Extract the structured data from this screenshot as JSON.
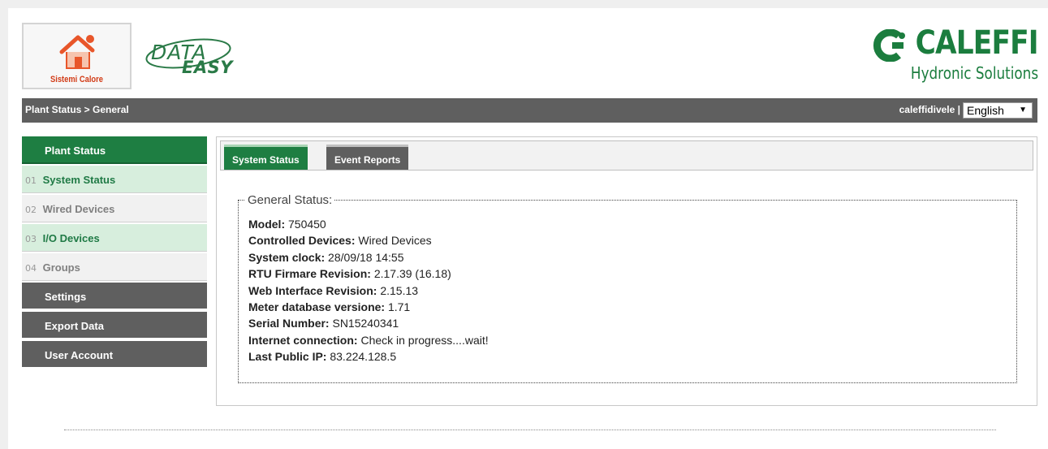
{
  "header": {
    "logo_text": "Sistemi Calore",
    "product_logo": {
      "word1": "DATA",
      "word2": "EASY"
    },
    "brand": {
      "name": "CALEFFI",
      "tagline": "Hydronic Solutions"
    }
  },
  "nav": {
    "breadcrumb": "Plant Status > General",
    "user": "caleffidivele |",
    "language": "English"
  },
  "sidebar": {
    "header": "Plant Status",
    "items": [
      {
        "num": "01",
        "label": "System Status",
        "state": "active"
      },
      {
        "num": "02",
        "label": "Wired Devices",
        "state": "inactive"
      },
      {
        "num": "03",
        "label": "I/O Devices",
        "state": "active"
      },
      {
        "num": "04",
        "label": "Groups",
        "state": "inactive"
      }
    ],
    "sections": [
      "Settings",
      "Export Data",
      "User Account"
    ]
  },
  "tabs": [
    {
      "label": "System Status",
      "active": true
    },
    {
      "label": "Event Reports",
      "active": false
    }
  ],
  "status": {
    "legend": "General Status:",
    "rows": [
      {
        "key": "Model:",
        "value": " 750450"
      },
      {
        "key": "Controlled Devices:",
        "value": " Wired Devices"
      },
      {
        "key": "System clock:",
        "value": " 28/09/18 14:55"
      },
      {
        "key": "RTU Firmare Revision:",
        "value": " 2.17.39 (16.18)"
      },
      {
        "key": "Web Interface Revision:",
        "value": " 2.15.13"
      },
      {
        "key": "Meter database versione:",
        "value": " 1.71"
      },
      {
        "key": "Serial Number:",
        "value": " SN15240341"
      },
      {
        "key": "Internet connection:",
        "value": " Check in progress....wait!"
      },
      {
        "key": "Last Public IP:",
        "value": " 83.224.128.5"
      }
    ]
  },
  "colors": {
    "green": "#1e7e42",
    "dark_gray": "#5f5f5f",
    "light_green": "#d7eedd",
    "brand_green": "#1b7d3e",
    "logo_orange": "#e8562a"
  },
  "icons": {
    "logo": "house-icon",
    "brand": "caleffi-c-icon",
    "dropdown": "chevron-down-icon"
  }
}
